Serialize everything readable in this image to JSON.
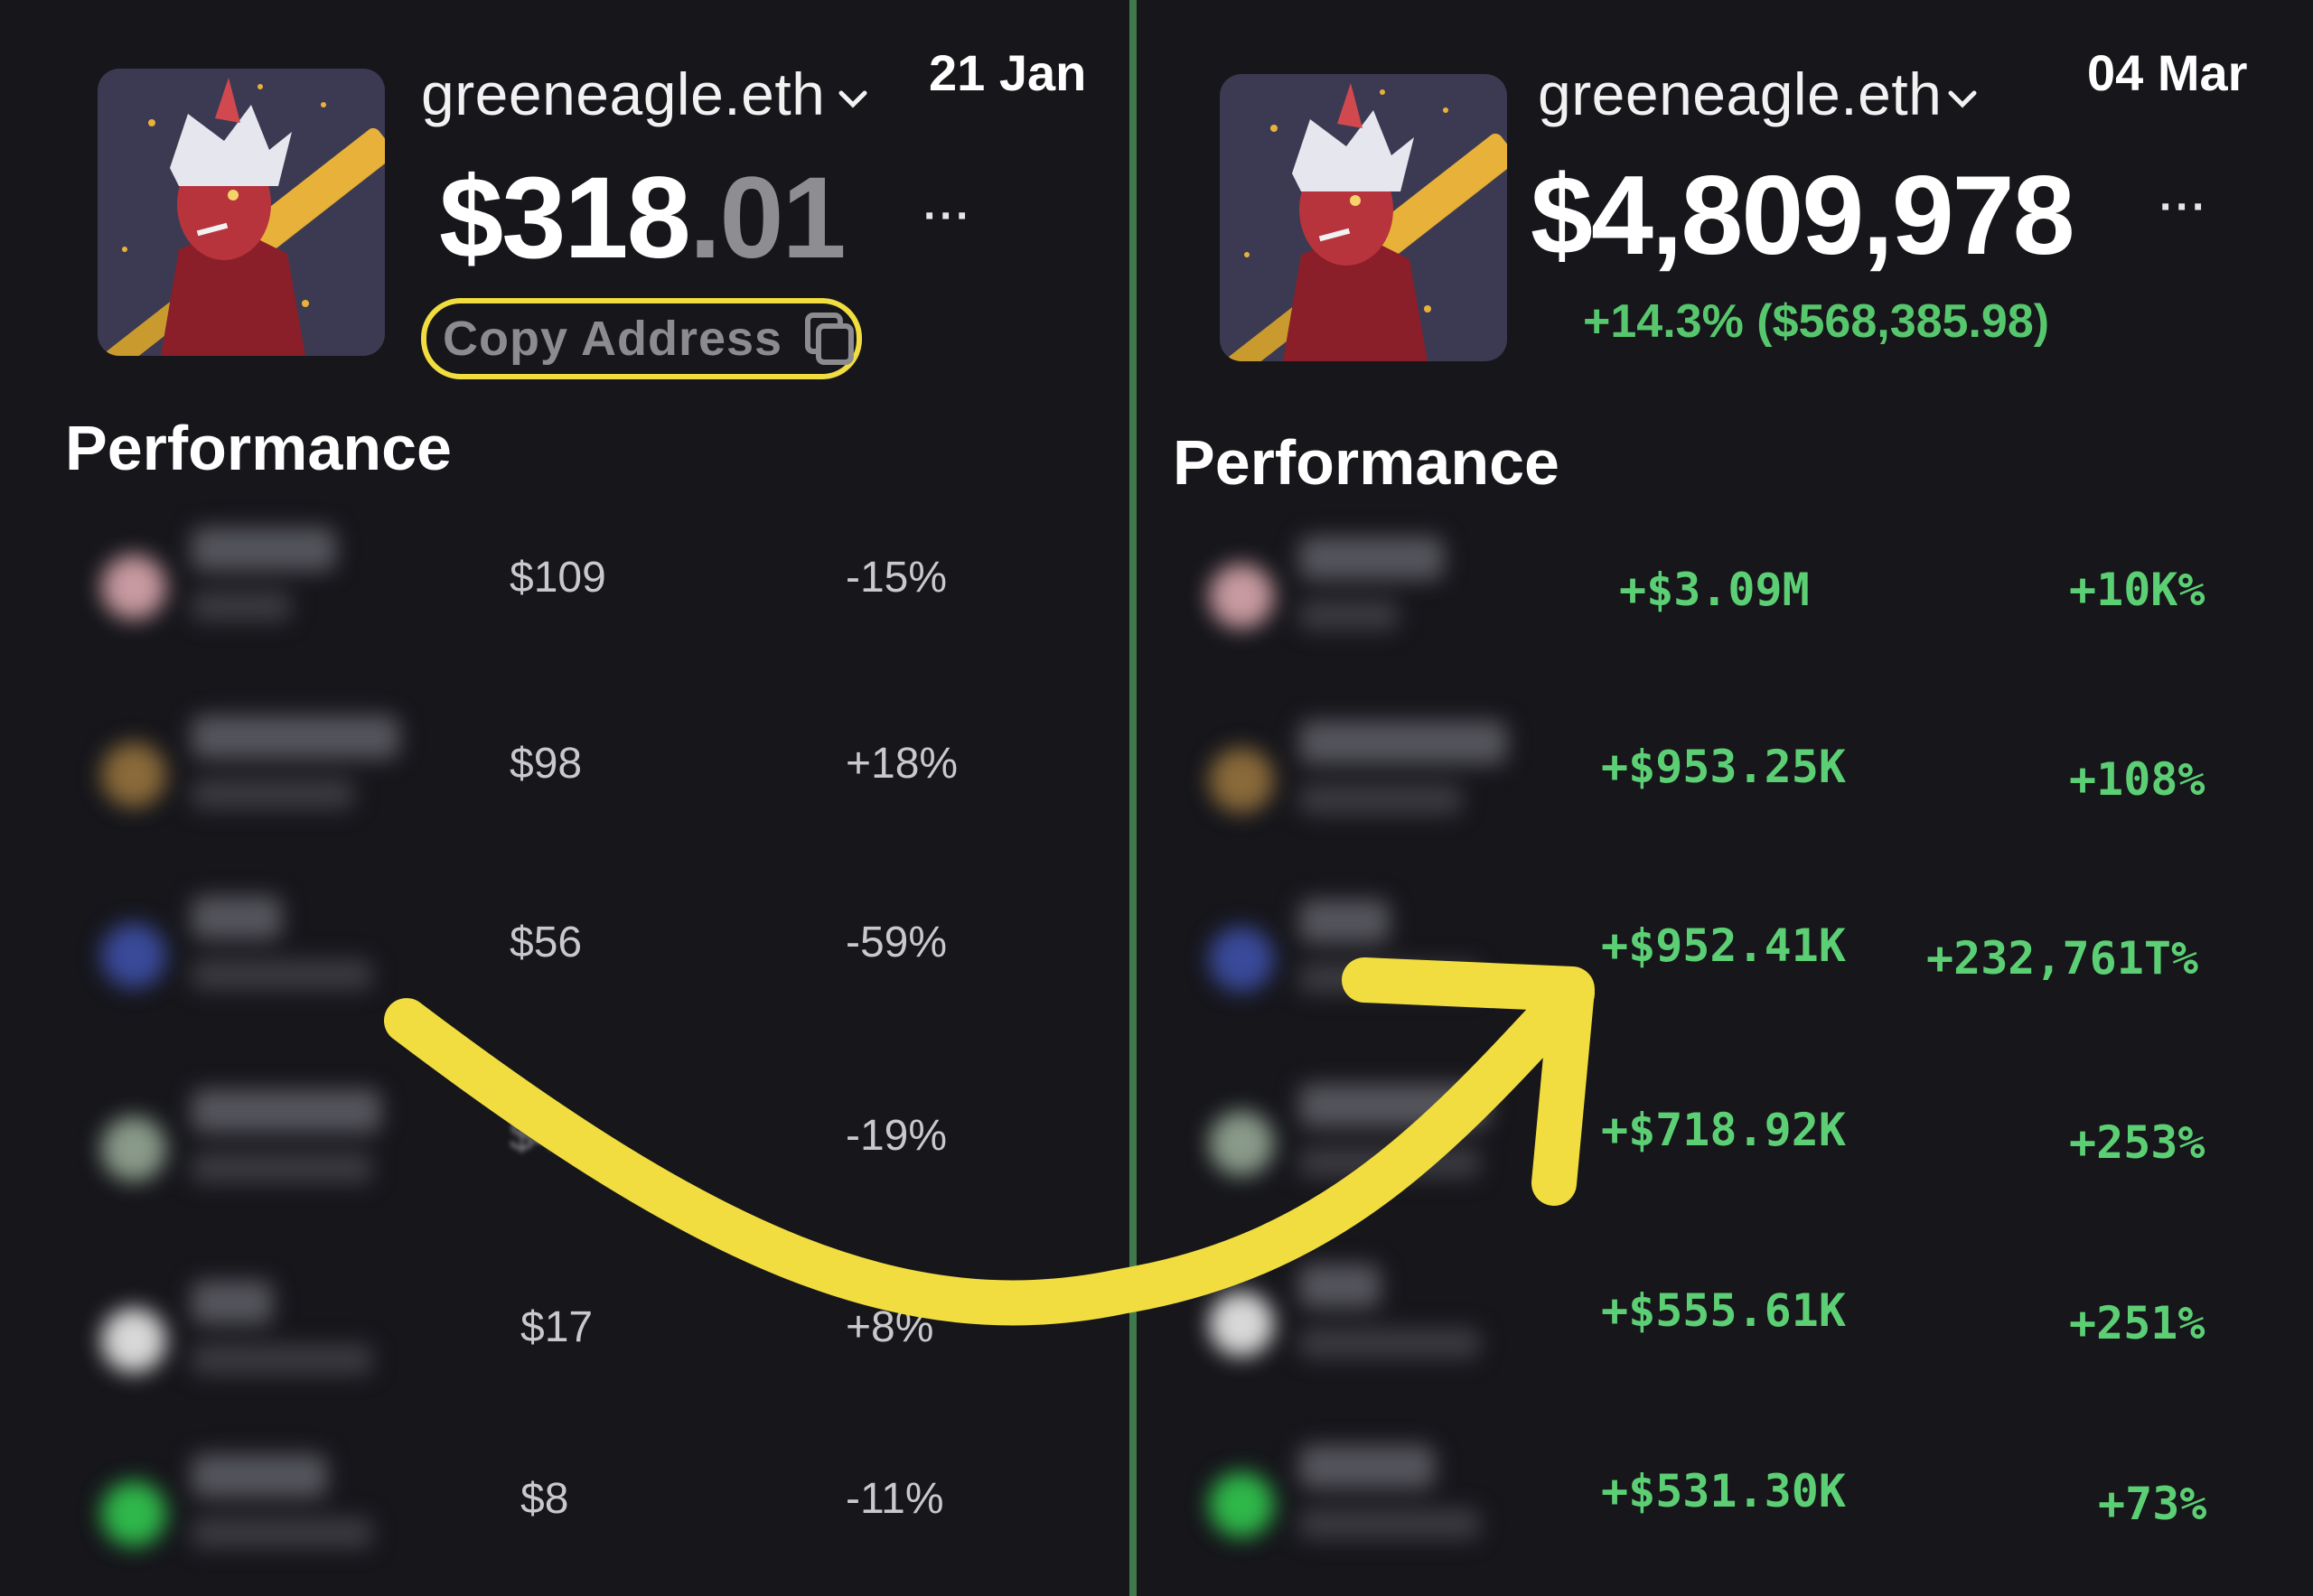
{
  "left": {
    "wallet_name": "greeneagle.eth",
    "date": "21 Jan",
    "balance_whole": "$318",
    "balance_cents": ".01",
    "more_label": "···",
    "copy_label": "Copy Address",
    "section_title": "Performance",
    "rows": [
      {
        "value": "$109",
        "pct": "-15%"
      },
      {
        "value": "$98",
        "pct": "+18%"
      },
      {
        "value": "$56",
        "pct": "-59%"
      },
      {
        "value": "$41",
        "pct": "-19%"
      },
      {
        "value": "$17",
        "pct": "+8%"
      },
      {
        "value": "$8",
        "pct": "-11%"
      }
    ]
  },
  "right": {
    "wallet_name": "greeneagle.eth",
    "date": "04 Mar",
    "balance": "$4,809,978",
    "more_label": "···",
    "change": "+14.3% ($568,385.98)",
    "section_title": "Performance",
    "rows": [
      {
        "value": "+$3.09M",
        "pct": "+10K%"
      },
      {
        "value": "+$953.25K",
        "pct": "+108%"
      },
      {
        "value": "+$952.41K",
        "pct": "+232,761T%"
      },
      {
        "value": "+$718.92K",
        "pct": "+253%"
      },
      {
        "value": "+$555.61K",
        "pct": "+251%"
      },
      {
        "value": "+$531.30K",
        "pct": "+73%"
      }
    ]
  },
  "token_logo_colors": [
    "#c79aa0",
    "#8a6a3a",
    "#3a4a9a",
    "#8a9a8a",
    "#d8d8d8",
    "#2fb84a"
  ],
  "colors": {
    "background": "#16161b",
    "gain": "#5ccf74",
    "highlight": "#f1dd3f",
    "divider": "#3f7a4d"
  },
  "icons": [
    "chevron-down-icon",
    "copy-icon",
    "more-icon",
    "arrow-annotation"
  ]
}
